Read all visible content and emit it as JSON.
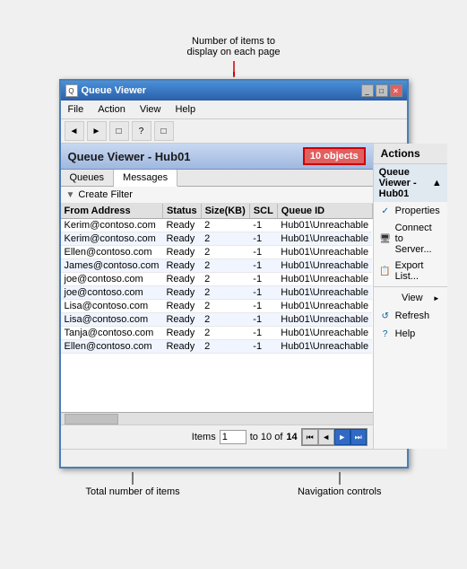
{
  "annotation": {
    "top_label": "Number of items to\ndisplay on each page",
    "bottom_left_label": "Total number of items",
    "bottom_right_label": "Navigation controls"
  },
  "window": {
    "title": "Queue Viewer",
    "title_controls": [
      "_",
      "□",
      "X"
    ]
  },
  "menu": {
    "items": [
      "File",
      "Action",
      "View",
      "Help"
    ]
  },
  "toolbar": {
    "buttons": [
      "◄",
      "►",
      "□",
      "?",
      "□"
    ]
  },
  "panel": {
    "title": "Queue Viewer - Hub01",
    "badge": "10 objects"
  },
  "tabs": {
    "items": [
      "Queues",
      "Messages"
    ],
    "active": 1
  },
  "filter": {
    "label": "Create Filter"
  },
  "table": {
    "columns": [
      "From Address",
      "Status",
      "Size(KB)",
      "SCL",
      "Queue ID"
    ],
    "rows": [
      [
        "Kerim@contoso.com",
        "Ready",
        "2",
        "-1",
        "Hub01\\Unreachable"
      ],
      [
        "Kerim@contoso.com",
        "Ready",
        "2",
        "-1",
        "Hub01\\Unreachable"
      ],
      [
        "Ellen@contoso.com",
        "Ready",
        "2",
        "-1",
        "Hub01\\Unreachable"
      ],
      [
        "James@contoso.com",
        "Ready",
        "2",
        "-1",
        "Hub01\\Unreachable"
      ],
      [
        "joe@contoso.com",
        "Ready",
        "2",
        "-1",
        "Hub01\\Unreachable"
      ],
      [
        "joe@contoso.com",
        "Ready",
        "2",
        "-1",
        "Hub01\\Unreachable"
      ],
      [
        "Lisa@contoso.com",
        "Ready",
        "2",
        "-1",
        "Hub01\\Unreachable"
      ],
      [
        "Lisa@contoso.com",
        "Ready",
        "2",
        "-1",
        "Hub01\\Unreachable"
      ],
      [
        "Tanja@contoso.com",
        "Ready",
        "2",
        "-1",
        "Hub01\\Unreachable"
      ],
      [
        "Ellen@contoso.com",
        "Ready",
        "2",
        "-1",
        "Hub01\\Unreachable"
      ]
    ]
  },
  "pagination": {
    "items_label": "Items",
    "current_page": "1",
    "page_of_label": "to 10 of",
    "total": "14",
    "nav_buttons": [
      "⏮",
      "◄",
      "►",
      "⏭"
    ]
  },
  "actions": {
    "header": "Actions",
    "section": "Queue Viewer - Hub01",
    "items": [
      {
        "icon": "✓",
        "icon_color": "#0060a0",
        "label": "Properties"
      },
      {
        "icon": "🖥",
        "icon_color": "#333",
        "label": "Connect to Server..."
      },
      {
        "icon": "📋",
        "icon_color": "#006000",
        "label": "Export List..."
      },
      {
        "icon": "",
        "label": "View",
        "has_submenu": true
      },
      {
        "icon": "↺",
        "icon_color": "#0060a0",
        "label": "Refresh"
      },
      {
        "icon": "?",
        "icon_color": "#0060a0",
        "label": "Help"
      }
    ]
  }
}
